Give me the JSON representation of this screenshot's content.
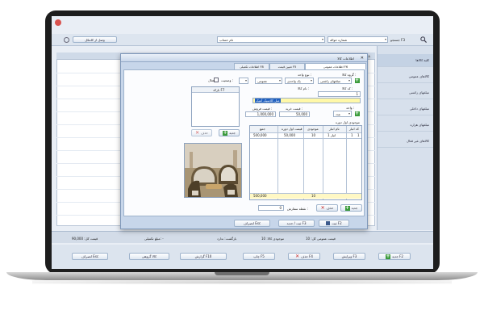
{
  "app": {
    "search_label": "جستجو F3",
    "field_selector": "شماره حواله",
    "filter_selector": "نام حساب",
    "connect_label": "وصل از کانتکل",
    "group_header": "گروه کالا F11",
    "grid_header_name": "نام کد",
    "sidebar_items": [
      "کلیه کالاها",
      "کالاهای عمومی",
      "مبلغهای زاشتی",
      "مبلغهای داخلی",
      "مبلغهای هزاره",
      "کالاهای غیر فعال"
    ],
    "summary": [
      "قیمت عمومی کل: 10",
      "موجودی کالا: 10",
      "بازگشت: ندارد",
      "مبلغ تکمیلی: -",
      "قیمت کل: 90,000"
    ],
    "footer_buttons": [
      "جدید F2",
      "ویرایش F3",
      "حذف F4",
      "چاپ F5",
      "گزارش F10",
      "کالا گروهی",
      "انصراف Esc"
    ]
  },
  "dialog": {
    "title": "اطلاعات کالا",
    "close_glyph": "✕",
    "tabs": [
      "اطلاعات عمومی F6",
      "تعیین قیمت F5",
      "اطلاعات تکمیلی F8"
    ],
    "label_group": "گروه کالا :",
    "group_value": "مبلغهای زاشتی",
    "label_unit": "نوع واحد :",
    "unit_value": "یک واحدی",
    "unit_type_value": "عمومی",
    "label_status": "وضعیت :",
    "status_value": "فعال",
    "label_code": "کد کالا :",
    "code_value": "1",
    "label_name": "نام کالا :",
    "name_value": "مبل کلاسیک آنتیک",
    "label_buy_price": "قیمت خرید :",
    "label_sell_price": "قیمت فروش :",
    "buy_price": "50,000",
    "sell_price": "1,000,000",
    "label_unit2": "واحد :",
    "unit2_value": "عدد",
    "label_opening": "موجودی اول دوره",
    "table_headers": [
      "کد انبار",
      "نام انبار",
      "موجودی",
      "قیمت اول دوره",
      "جمع"
    ],
    "row_code": "1",
    "row_marker": "1",
    "row_warehouse": "انبار 1",
    "row_qty": "10",
    "row_unit_price": "50,000",
    "row_total": "500,000",
    "total_qty": "10",
    "total_sum": "500,000",
    "btn_new": "جدید",
    "btn_delete": "حذف",
    "label_order_point": "نقطه سفارش :",
    "order_point_value": "0",
    "side_list_header": "بارکد F7",
    "side_btn_new": "جدید",
    "side_btn_delete": "حذف",
    "footer_save": "ثبت F2",
    "footer_save_new": "ثبت / جدید F3",
    "footer_cancel": "انصراف Esc"
  },
  "colors": {
    "highlight_input": "#fff8a8",
    "accent": "#3b9b3b",
    "danger": "#c62828"
  }
}
